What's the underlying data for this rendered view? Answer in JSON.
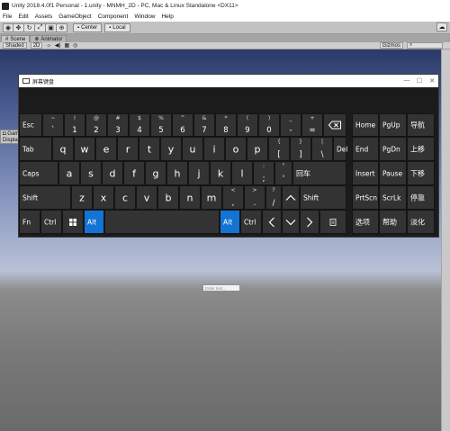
{
  "window": {
    "title": "Unity 2018.4.0f1 Personal - 1.unity - MNMH_2D - PC, Mac & Linux Standalone <DX11>"
  },
  "menu": [
    "File",
    "Edit",
    "Assets",
    "GameObject",
    "Component",
    "Window",
    "Help"
  ],
  "toolbar": {
    "pivot_label": "Center",
    "space_label": "Local"
  },
  "tabs": {
    "scene": "Scene",
    "animator": "Animator",
    "game": "Gam"
  },
  "scene_tools": {
    "shading": "Shaded",
    "mode2d": "2D",
    "gizmos": "Gizmos",
    "display": "Displa"
  },
  "scene_input": {
    "placeholder": "Enter text..."
  },
  "osk": {
    "title": "屏幕键盘",
    "keys": {
      "esc": "Esc",
      "grave_up": "~",
      "grave_dn": "`",
      "d1_up": "!",
      "d1_dn": "1",
      "d2_up": "@",
      "d2_dn": "2",
      "d3_up": "#",
      "d3_dn": "3",
      "d4_up": "$",
      "d4_dn": "4",
      "d5_up": "%",
      "d5_dn": "5",
      "d6_up": "^",
      "d6_dn": "6",
      "d7_up": "&",
      "d7_dn": "7",
      "d8_up": "*",
      "d8_dn": "8",
      "d9_up": "(",
      "d9_dn": "9",
      "d0_up": ")",
      "d0_dn": "0",
      "minus_up": "_",
      "minus_dn": "-",
      "eq_up": "+",
      "eq_dn": "=",
      "tab": "Tab",
      "q": "q",
      "w": "w",
      "e": "e",
      "r": "r",
      "t": "t",
      "y": "y",
      "u": "u",
      "i": "i",
      "o": "o",
      "p": "p",
      "lbr_up": "{",
      "lbr_dn": "[",
      "rbr_up": "}",
      "rbr_dn": "]",
      "bsl_up": "|",
      "bsl_dn": "\\",
      "del": "Del",
      "caps": "Caps",
      "a": "a",
      "s": "s",
      "d": "d",
      "f": "f",
      "g": "g",
      "h": "h",
      "j": "j",
      "k": "k",
      "l": "l",
      "semi_up": ":",
      "semi_dn": ";",
      "quote_up": "\"",
      "quote_dn": "'",
      "enter": "回车",
      "lshift": "Shift",
      "z": "z",
      "x": "x",
      "c": "c",
      "v": "v",
      "b": "b",
      "n": "n",
      "m": "m",
      "comma_up": "<",
      "comma_dn": ",",
      "period_up": ">",
      "period_dn": ".",
      "slash_up": "?",
      "slash_dn": "/",
      "rshift": "Shift",
      "fn": "Fn",
      "lctrl": "Ctrl",
      "lalt": "Alt",
      "ralt": "Alt",
      "rctrl": "Ctrl",
      "home": "Home",
      "pgup": "PgUp",
      "nav": "导航",
      "end": "End",
      "pgdn": "PgDn",
      "moveup": "上移",
      "insert": "Insert",
      "pause": "Pause",
      "movedown": "下移",
      "prtscn": "PrtScn",
      "scrlk": "ScrLk",
      "dock": "停靠",
      "options": "选项",
      "help": "帮助",
      "fade": "淡化"
    }
  },
  "colors": {
    "accent_blue": "#1474d4",
    "key_bg": "#333333",
    "keyboard_bg": "#1b1b1b"
  }
}
